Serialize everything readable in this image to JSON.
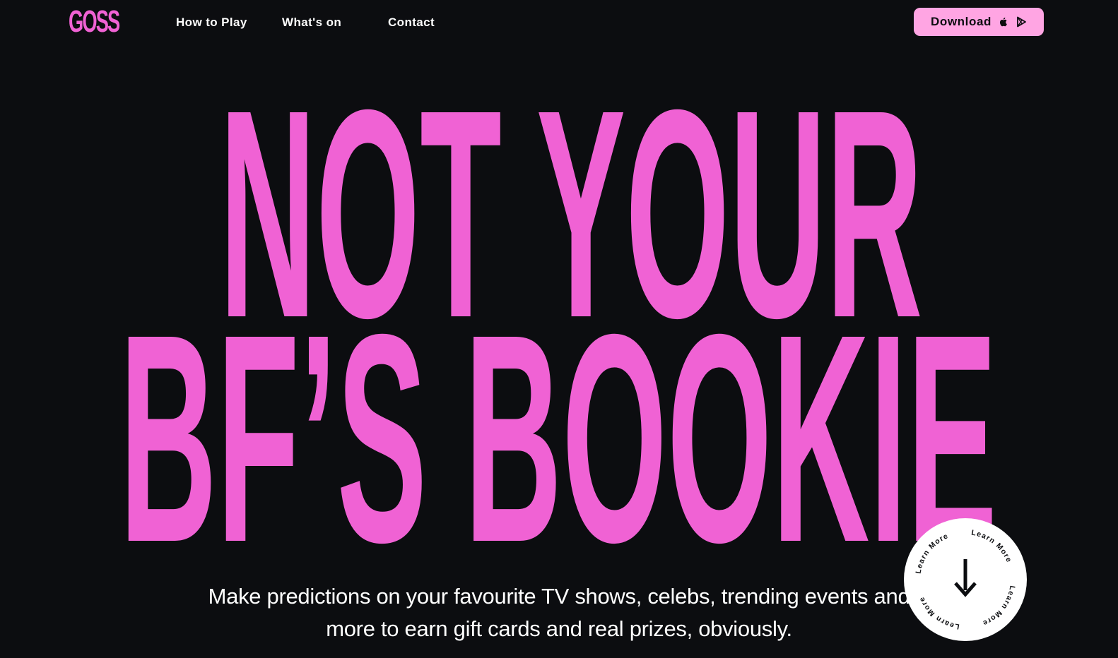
{
  "header": {
    "logo_text": "GOSS",
    "nav": [
      {
        "label": "How to Play"
      },
      {
        "label": "What's on"
      },
      {
        "label": "Contact"
      }
    ],
    "download_label": "Download",
    "download_icons": [
      "apple-icon",
      "google-play-icon"
    ]
  },
  "hero": {
    "headline_line1": "NOT YOUR",
    "headline_line2": "BF’S BOOKIE",
    "tagline": "Make predictions on your favourite TV shows, celebs, trending events and more to earn gift cards and real prizes, obviously.",
    "learn_more_label": "Learn More"
  },
  "colors": {
    "background": "#0c0d10",
    "brand_pink": "#f062d4",
    "button_pink": "#ffa5e3",
    "text_white": "#ffffff"
  }
}
